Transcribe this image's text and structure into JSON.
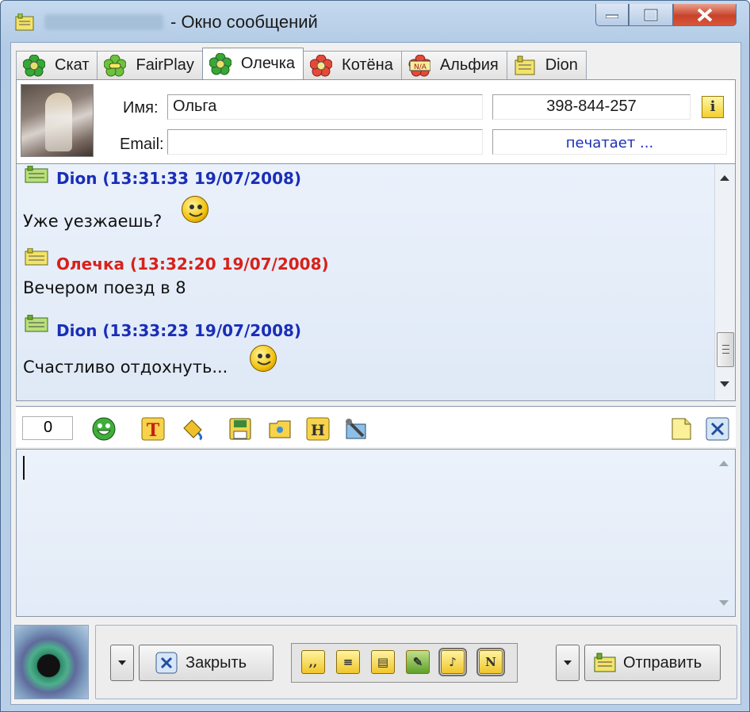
{
  "window": {
    "title": "- Окно сообщений"
  },
  "tabs": [
    {
      "label": "Скат",
      "icon": "green-flower-icon"
    },
    {
      "label": "FairPlay",
      "icon": "green-mask-icon"
    },
    {
      "label": "Олечка",
      "icon": "green-flower-icon",
      "active": true
    },
    {
      "label": "Котёна",
      "icon": "red-flower-icon"
    },
    {
      "label": "Альфия",
      "icon": "na-status-icon"
    },
    {
      "label": "Dion",
      "icon": "message-card-icon"
    }
  ],
  "contact": {
    "name_label": "Имя:",
    "name_value": "Ольга",
    "email_label": "Email:",
    "email_value": "",
    "uin": "398-844-257",
    "status": "печатает ..."
  },
  "messages": [
    {
      "author": "Dion",
      "header": "Dion (13:31:33 19/07/2008)",
      "text": "Уже уезжаешь?",
      "smiley": true
    },
    {
      "author": "Олечка",
      "header": "Олечка (13:32:20 19/07/2008)",
      "text": "Вечером поезд в 8",
      "smiley": false
    },
    {
      "author": "Dion",
      "header": "Dion (13:33:23 19/07/2008)",
      "text": "Счастливо отдохнуть...",
      "smiley": true
    }
  ],
  "toolbar": {
    "char_count": "0",
    "icons": [
      "smiley-icon",
      "text-color-icon",
      "background-fill-icon",
      "save-icon",
      "open-folder-icon",
      "history-icon",
      "tools-icon",
      "new-note-icon",
      "clear-icon"
    ]
  },
  "input": {
    "value": ""
  },
  "buttons": {
    "close_label": "Закрыть",
    "send_label": "Отправить",
    "quick": [
      {
        "name": "quote-icon",
        "text": ",,"
      },
      {
        "name": "message-icon",
        "text": ""
      },
      {
        "name": "file-transfer-icon",
        "text": ""
      },
      {
        "name": "settings-icon",
        "text": ""
      },
      {
        "name": "sound-icon",
        "text": "♪"
      },
      {
        "name": "notify-icon",
        "text": "N"
      }
    ]
  },
  "colors": {
    "dion": "#1a2eb8",
    "olechka": "#d8211a",
    "accent": "#f2c20c"
  }
}
